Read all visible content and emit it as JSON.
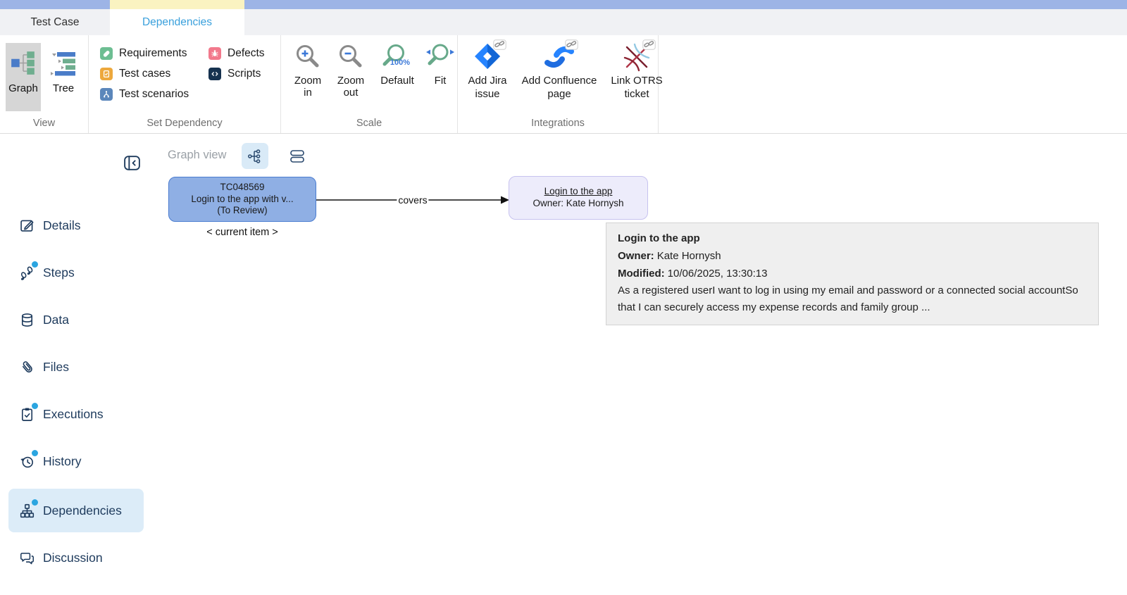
{
  "tabs": {
    "test_case": "Test Case",
    "dependencies": "Dependencies"
  },
  "ribbon": {
    "view": {
      "label": "View",
      "graph": "Graph",
      "tree": "Tree"
    },
    "set_dependency": {
      "label": "Set Dependency",
      "items": [
        "Requirements",
        "Test cases",
        "Test scenarios",
        "Defects",
        "Scripts"
      ]
    },
    "scale": {
      "label": "Scale",
      "zoom_in": [
        "Zoom",
        "in"
      ],
      "zoom_out": [
        "Zoom",
        "out"
      ],
      "default": "Default",
      "default_badge": "100%",
      "fit": "Fit"
    },
    "integrations": {
      "label": "Integrations",
      "jira": [
        "Add Jira",
        "issue"
      ],
      "confluence": [
        "Add Confluence",
        "page"
      ],
      "otrs": [
        "Link OTRS",
        "ticket"
      ]
    }
  },
  "sidebar": {
    "items": [
      {
        "label": "Details"
      },
      {
        "label": "Steps"
      },
      {
        "label": "Data"
      },
      {
        "label": "Files"
      },
      {
        "label": "Executions"
      },
      {
        "label": "History"
      },
      {
        "label": "Dependencies"
      },
      {
        "label": "Discussion"
      }
    ]
  },
  "graph_panel": {
    "view_label": "Graph view",
    "node_current": {
      "line1": "TC048569",
      "line2": "Login to the app with v...",
      "line3": "(To Review)"
    },
    "current_marker": "< current item >",
    "edge_label": "covers",
    "node_target": {
      "title": "Login to the app",
      "owner": "Owner: Kate Hornysh"
    }
  },
  "tooltip": {
    "title": "Login to the app",
    "owner_label": "Owner:",
    "owner_value": "Kate Hornysh",
    "modified_label": "Modified:",
    "modified_value": "10/06/2025, 13:30:13",
    "description": "As a registered userI want to log in using my email and password or a connected social accountSo that I can securely access my expense records and family group ..."
  },
  "colors": {
    "title_strip": "#9db4e6",
    "tab_highlight": "#faf3c1",
    "accent_blue": "#3aa0dc",
    "badge_dot": "#2ba5e0",
    "node_current_fill": "#8fafe4",
    "node_current_border": "#4a7cd0",
    "node_target_fill": "#edecfb",
    "node_target_border": "#c7c2ef"
  }
}
